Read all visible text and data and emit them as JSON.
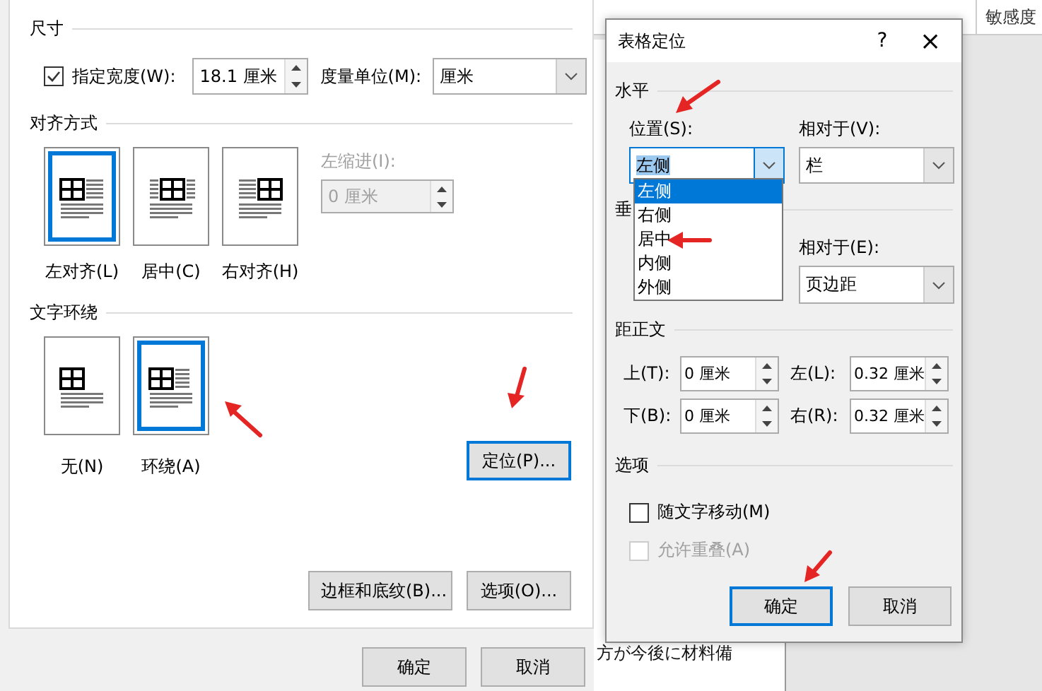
{
  "table_properties_dialog": {
    "size_section": {
      "title": "尺寸",
      "preferred_width": {
        "label": "指定宽度(W):",
        "checked": true,
        "value": "18.1 厘米"
      },
      "measure_in": {
        "label": "度量单位(M):",
        "value": "厘米"
      }
    },
    "alignment_section": {
      "title": "对齐方式",
      "options": [
        {
          "label": "左对齐(L)",
          "kind": "left",
          "selected": true
        },
        {
          "label": "居中(C)",
          "kind": "center",
          "selected": false
        },
        {
          "label": "右对齐(H)",
          "kind": "right",
          "selected": false
        }
      ],
      "indent_from_left": {
        "label": "左缩进(I):",
        "value": "0 厘米",
        "disabled": true
      }
    },
    "wrapping_section": {
      "title": "文字环绕",
      "options": [
        {
          "label": "无(N)",
          "kind": "none",
          "selected": false
        },
        {
          "label": "环绕(A)",
          "kind": "around",
          "selected": true
        }
      ],
      "positioning_button": {
        "label": "定位(P)...",
        "focused": true
      }
    },
    "panel_buttons": [
      {
        "label": "边框和底纹(B)...",
        "focused": false
      },
      {
        "label": "选项(O)...",
        "focused": false
      }
    ],
    "buttons": [
      {
        "label": "确定",
        "focused": false
      },
      {
        "label": "取消",
        "focused": false
      }
    ]
  },
  "document": {
    "header_cell": "敏感度",
    "text_line": "方が今後に材料備"
  },
  "table_positioning_dialog": {
    "title": "表格定位",
    "help": "?",
    "close": "×",
    "horizontal_section": {
      "title": "水平",
      "position": {
        "label": "位置(S):",
        "value": "左侧",
        "open": true,
        "options": [
          {
            "label": "左侧",
            "selected": true
          },
          {
            "label": "右侧",
            "selected": false
          },
          {
            "label": "居中",
            "selected": false
          },
          {
            "label": "内侧",
            "selected": false
          },
          {
            "label": "外侧",
            "selected": false
          }
        ]
      },
      "relative_to": {
        "label": "相对于(V):",
        "value": "栏"
      }
    },
    "vertical_section": {
      "title": "垂",
      "relative_to": {
        "label": "相对于(E):",
        "value": "页边距"
      }
    },
    "distance_section": {
      "title": "距正文",
      "fields": [
        {
          "label": "上(T):",
          "value": "0 厘米"
        },
        {
          "label": "左(L):",
          "value": "0.32 厘米"
        },
        {
          "label": "下(B):",
          "value": "0 厘米"
        },
        {
          "label": "右(R):",
          "value": "0.32 厘米"
        }
      ]
    },
    "options_section": {
      "title": "选项",
      "checkboxes": [
        {
          "label": "随文字移动(M)",
          "checked": false,
          "disabled": false
        },
        {
          "label": "允许重叠(A)",
          "checked": false,
          "disabled": true
        }
      ]
    },
    "buttons": [
      {
        "label": "确定",
        "focused": true
      },
      {
        "label": "取消",
        "focused": false
      }
    ]
  }
}
